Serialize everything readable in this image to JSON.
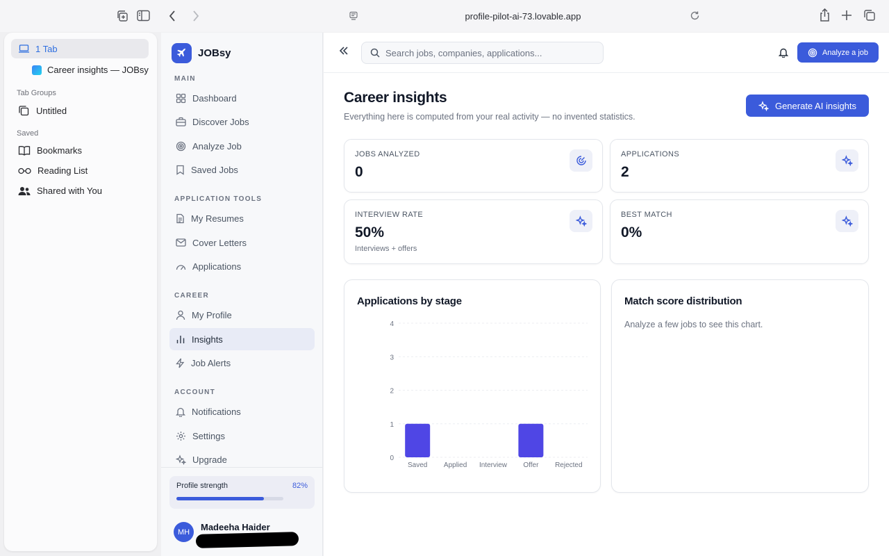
{
  "browser": {
    "url": "profile-pilot-ai-73.lovable.app"
  },
  "safari_sidebar": {
    "tab_count": "1 Tab",
    "open_tab": "Career insights — JOBsy",
    "tab_groups_header": "Tab Groups",
    "tab_group": "Untitled",
    "saved_header": "Saved",
    "saved_items": [
      "Bookmarks",
      "Reading List",
      "Shared with You"
    ]
  },
  "app": {
    "brand": "JOBsy",
    "sections": {
      "main": "MAIN",
      "tools": "APPLICATION TOOLS",
      "career": "CAREER",
      "account": "ACCOUNT"
    },
    "nav": {
      "dashboard": "Dashboard",
      "discover": "Discover Jobs",
      "analyze": "Analyze Job",
      "saved": "Saved Jobs",
      "resumes": "My Resumes",
      "cover": "Cover Letters",
      "applications": "Applications",
      "profile": "My Profile",
      "insights": "Insights",
      "alerts": "Job Alerts",
      "notifications": "Notifications",
      "settings": "Settings",
      "upgrade": "Upgrade"
    },
    "profile_strength": {
      "label": "Profile strength",
      "percent_text": "82%",
      "value": 0.82
    },
    "user": {
      "initials": "MH",
      "name": "Madeeha Haider"
    }
  },
  "header": {
    "search_placeholder": "Search jobs, companies, applications...",
    "analyze_button": "Analyze a job"
  },
  "page": {
    "title": "Career insights",
    "subtitle": "Everything here is computed from your real activity — no invented statistics.",
    "generate_button": "Generate AI insights"
  },
  "stats": {
    "jobs_analyzed": {
      "label": "JOBS ANALYZED",
      "value": "0"
    },
    "applications": {
      "label": "APPLICATIONS",
      "value": "2"
    },
    "interview_rate": {
      "label": "INTERVIEW RATE",
      "value": "50%",
      "note": "Interviews + offers"
    },
    "best_match": {
      "label": "BEST MATCH",
      "value": "0%"
    }
  },
  "match_card": {
    "title": "Match score distribution",
    "message": "Analyze a few jobs to see this chart."
  },
  "chart_data": {
    "type": "bar",
    "title": "Applications by stage",
    "categories": [
      "Saved",
      "Applied",
      "Interview",
      "Offer",
      "Rejected"
    ],
    "values": [
      1,
      0,
      0,
      1,
      0
    ],
    "ylim": [
      0,
      4
    ],
    "yticks": [
      0,
      1,
      2,
      3,
      4
    ],
    "grid": true,
    "bar_color": "#4f46e5"
  },
  "colors": {
    "accent": "#3b5bdb",
    "bar": "#4f46e5"
  }
}
